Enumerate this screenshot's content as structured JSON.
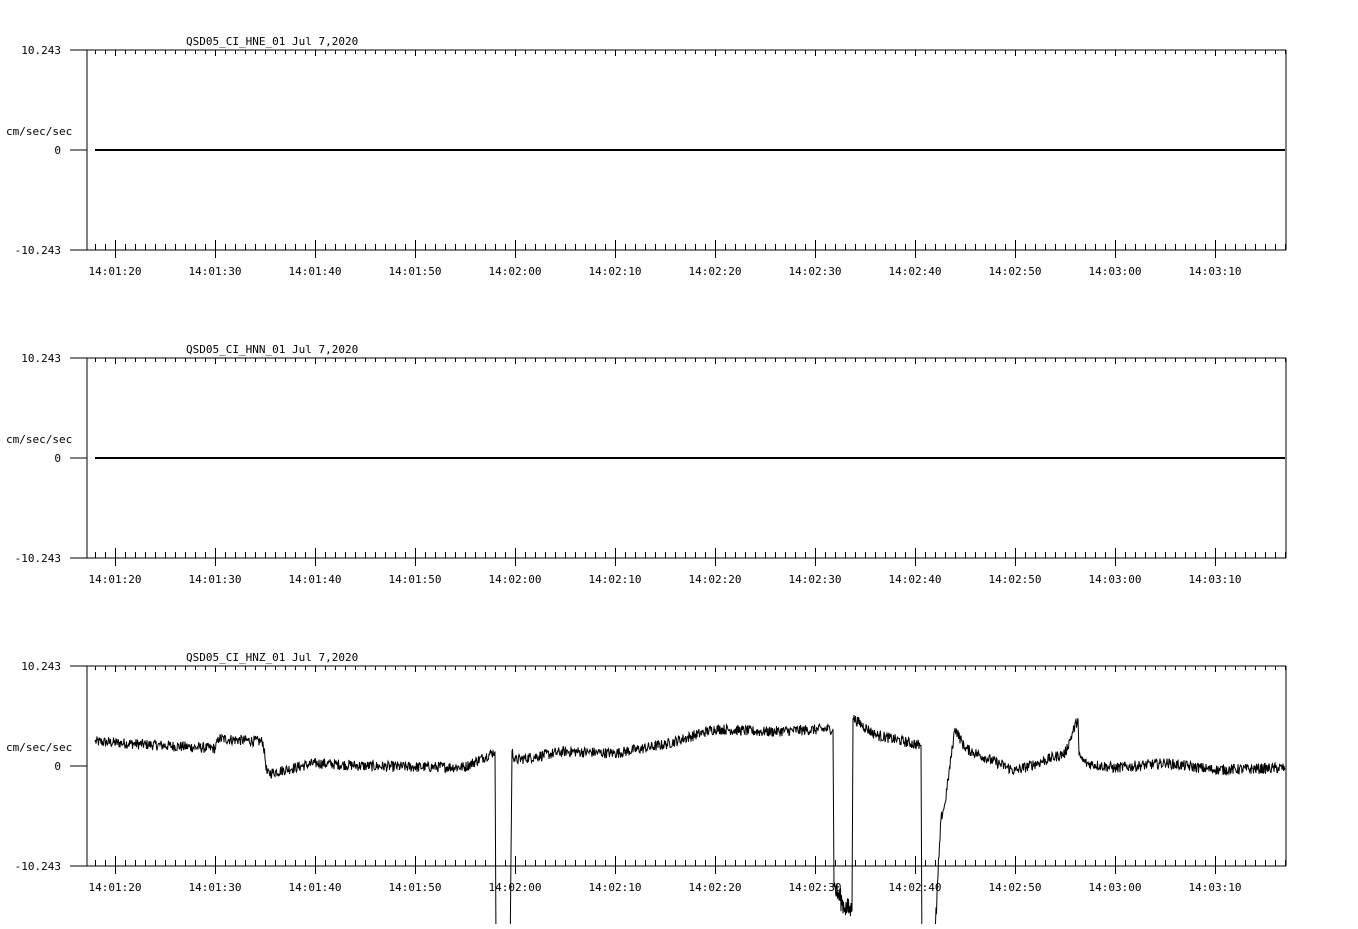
{
  "chart_data": [
    {
      "type": "line",
      "title": "QSD05_CI_HNE_01  Jul 7,2020",
      "ylabel": "cm/sec/sec",
      "ylim": [
        -10.243,
        10.243
      ],
      "y_ticks": [
        "10.243",
        "0",
        "-10.243"
      ],
      "x_ticks": [
        "14:01:20",
        "14:01:30",
        "14:01:40",
        "14:01:50",
        "14:02:00",
        "14:02:10",
        "14:02:20",
        "14:02:30",
        "14:02:40",
        "14:02:50",
        "14:03:00",
        "14:03:10"
      ],
      "series": [
        {
          "x": [
            "14:01:18",
            "14:03:17"
          ],
          "values": [
            0,
            0
          ]
        }
      ]
    },
    {
      "type": "line",
      "title": "QSD05_CI_HNN_01  Jul 7,2020",
      "ylabel": "cm/sec/sec",
      "ylim": [
        -10.243,
        10.243
      ],
      "y_ticks": [
        "10.243",
        "0",
        "-10.243"
      ],
      "x_ticks": [
        "14:01:20",
        "14:01:30",
        "14:01:40",
        "14:01:50",
        "14:02:00",
        "14:02:10",
        "14:02:20",
        "14:02:30",
        "14:02:40",
        "14:02:50",
        "14:03:00",
        "14:03:10"
      ],
      "series": [
        {
          "x": [
            "14:01:18",
            "14:03:17"
          ],
          "values": [
            0,
            0
          ]
        }
      ]
    },
    {
      "type": "line",
      "title": "QSD05_CI_HNZ_01  Jul 7,2020",
      "ylabel": "cm/sec/sec",
      "ylim": [
        -10.243,
        10.243
      ],
      "y_ticks": [
        "10.243",
        "0",
        "-10.243"
      ],
      "x_ticks": [
        "14:01:20",
        "14:01:30",
        "14:01:40",
        "14:01:50",
        "14:02:00",
        "14:02:10",
        "14:02:20",
        "14:02:30",
        "14:02:40",
        "14:02:50",
        "14:03:00",
        "14:03:10"
      ],
      "series": [
        {
          "x": [
            "14:01:18",
            "14:01:30",
            "14:01:30.4",
            "14:01:34.8",
            "14:01:35.2",
            "14:01:40",
            "14:01:45",
            "14:01:50",
            "14:01:55",
            "14:01:58",
            "14:01:58.1",
            "14:01:59.5",
            "14:01:59.7",
            "14:02:00",
            "14:02:05",
            "14:02:10",
            "14:02:15",
            "14:02:20",
            "14:02:25",
            "14:02:31.8",
            "14:02:31.9",
            "14:02:33",
            "14:02:33.7",
            "14:02:33.8",
            "14:02:36",
            "14:02:40.6",
            "14:02:40.7",
            "14:02:42",
            "14:02:42.6",
            "14:02:43",
            "14:02:44",
            "14:02:45",
            "14:02:50",
            "14:02:55",
            "14:02:56.3",
            "14:02:56.4",
            "14:02:57",
            "14:03:00",
            "14:03:05",
            "14:03:10",
            "14:03:17"
          ],
          "values": [
            2.5,
            1.8,
            2.8,
            2.5,
            -0.8,
            0.3,
            0,
            -0.1,
            -0.1,
            1.5,
            -18.5,
            -19.9,
            1.5,
            0.6,
            1.5,
            1.3,
            2.2,
            3.8,
            3.5,
            3.8,
            -12.4,
            -14.5,
            -14.8,
            4.9,
            3.2,
            2.1,
            -19.9,
            -17.5,
            -5.4,
            -3.8,
            3.9,
            1.8,
            -0.5,
            1.3,
            4.9,
            1.1,
            0.3,
            -0.2,
            0.3,
            -0.4,
            -0.2
          ]
        }
      ]
    }
  ]
}
